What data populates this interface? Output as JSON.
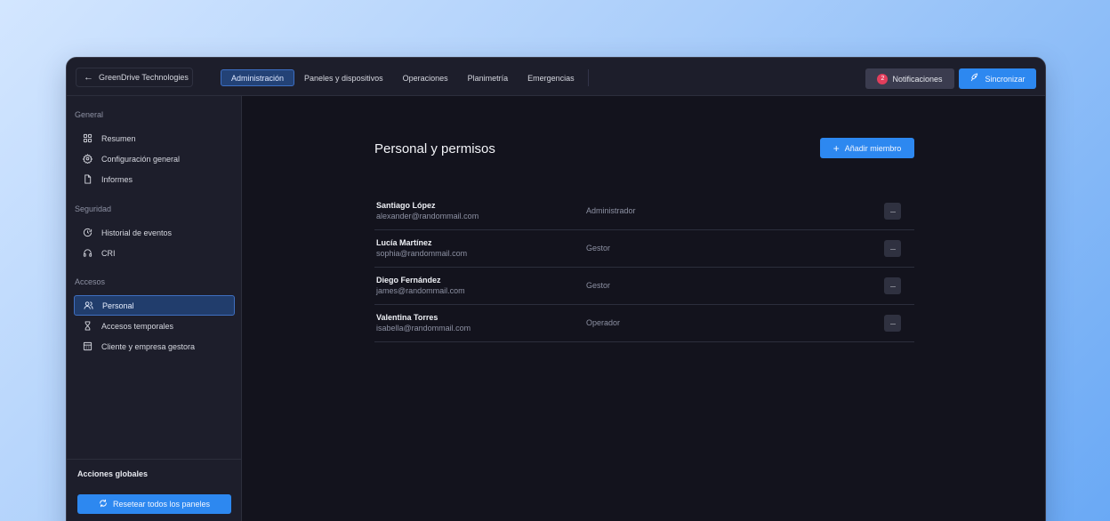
{
  "topbar": {
    "back_label": "GreenDrive Technologies",
    "tabs": [
      {
        "label": "Administración",
        "active": true
      },
      {
        "label": "Paneles y dispositivos",
        "active": false
      },
      {
        "label": "Operaciones",
        "active": false
      },
      {
        "label": "Planimetría",
        "active": false
      },
      {
        "label": "Emergencias",
        "active": false
      }
    ],
    "notifications_label": "Notificaciones",
    "notifications_count": "2",
    "sync_label": "Sincronizar"
  },
  "sidebar": {
    "sections": [
      {
        "title": "General",
        "items": [
          {
            "label": "Resumen",
            "icon": "grid-icon"
          },
          {
            "label": "Configuración general",
            "icon": "gear-icon"
          },
          {
            "label": "Informes",
            "icon": "file-icon"
          }
        ]
      },
      {
        "title": "Seguridad",
        "items": [
          {
            "label": "Historial de eventos",
            "icon": "history-icon"
          },
          {
            "label": "CRI",
            "icon": "headset-icon"
          }
        ]
      },
      {
        "title": "Accesos",
        "items": [
          {
            "label": "Personal",
            "icon": "users-icon",
            "active": true
          },
          {
            "label": "Accesos temporales",
            "icon": "hourglass-icon"
          },
          {
            "label": "Cliente y empresa gestora",
            "icon": "building-icon"
          }
        ]
      }
    ],
    "footer_title": "Acciones globales",
    "reset_label": "Resetear todos los paneles"
  },
  "main": {
    "title": "Personal y permisos",
    "add_label": "Añadir miembro",
    "members": [
      {
        "name": "Santiago López",
        "email": "alexander@randommail.com",
        "role": "Administrador"
      },
      {
        "name": "Lucía Martínez",
        "email": "sophia@randommail.com",
        "role": "Gestor"
      },
      {
        "name": "Diego Fernández",
        "email": "james@randommail.com",
        "role": "Gestor"
      },
      {
        "name": "Valentina Torres",
        "email": "isabella@randommail.com",
        "role": "Operador"
      }
    ],
    "more_label": "···"
  },
  "colors": {
    "accent": "#2d88f0",
    "active_tab": "#234276",
    "badge": "#e23e5c",
    "panel": "#1d1e2b",
    "content": "#13131d"
  }
}
